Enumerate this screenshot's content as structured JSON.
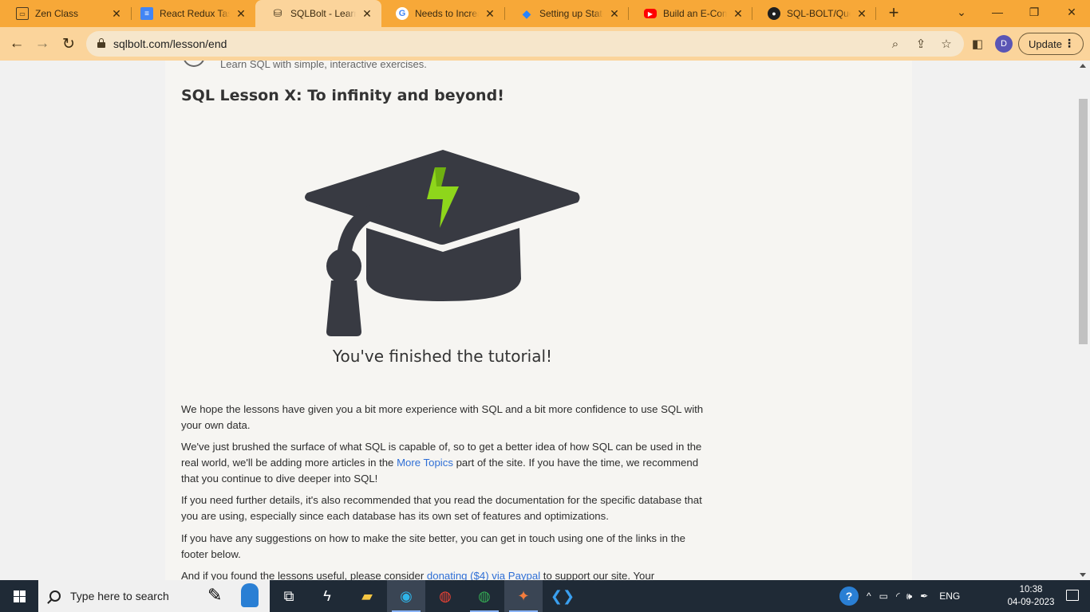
{
  "browser": {
    "tabs": [
      {
        "title": "Zen Class",
        "icon": "zen-class-icon",
        "active": false
      },
      {
        "title": "React Redux Task",
        "icon": "google-docs-icon",
        "active": false
      },
      {
        "title": "SQLBolt - Learn S",
        "icon": "sqlbolt-icon",
        "active": true
      },
      {
        "title": "Needs to Increas",
        "icon": "google-icon",
        "active": false
      },
      {
        "title": "Setting up State M",
        "icon": "jira-icon",
        "active": false
      },
      {
        "title": "Build an E-Comm",
        "icon": "youtube-icon",
        "active": false
      },
      {
        "title": "SQL-BOLT/Query",
        "icon": "github-icon",
        "active": false
      }
    ],
    "url": "sqlbolt.com/lesson/end",
    "profile_initial": "D",
    "update_label": "Update",
    "colors": {
      "tabstrip": "#f7a838",
      "toolbar": "#fbd49b"
    }
  },
  "page": {
    "tagline": "Learn SQL with simple, interactive exercises.",
    "lesson_title": "SQL Lesson X: To infinity and beyond!",
    "finished_text": "You've finished the tutorial!",
    "paragraphs": {
      "p1": "We hope the lessons have given you a bit more experience with SQL and a bit more confidence to use SQL with your own data.",
      "p2_before": "We've just brushed the surface of what SQL is capable of, so to get a better idea of how SQL can be used in the real world, we'll be adding more articles in the ",
      "p2_link": "More Topics",
      "p2_after": " part of the site. If you have the time, we recommend that you continue to dive deeper into SQL!",
      "p3": "If you need further details, it's also recommended that you read the documentation for the specific database that you are using, especially since each database has its own set of features and optimizations.",
      "p4": "If you have any suggestions on how to make the site better, you can get in touch using one of the links in the footer below.",
      "p5_before": "And if you found the lessons useful, please consider ",
      "p5_link": "donating ($4) via Paypal",
      "p5_after": " to support our site. Your"
    },
    "colors": {
      "link": "#2f6fd6",
      "hat": "#383a42",
      "bolt": "#8ed61b"
    }
  },
  "taskbar": {
    "search_placeholder": "Type here to search",
    "language": "ENG",
    "time": "10:38",
    "date": "04-09-2023"
  }
}
